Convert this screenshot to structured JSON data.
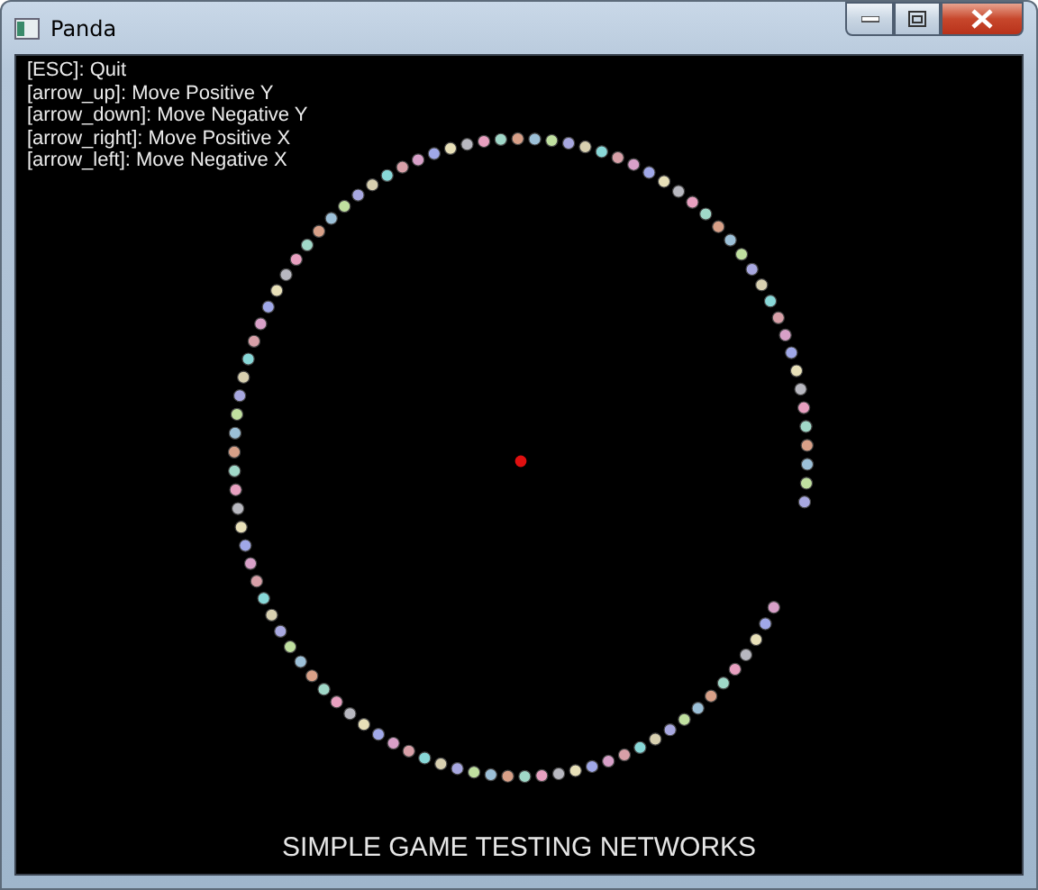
{
  "window": {
    "title": "Panda"
  },
  "help_lines": [
    "[ESC]: Quit",
    "[arrow_up]: Move Positive Y",
    "[arrow_down]: Move Negative Y",
    "[arrow_right]: Move Positive X",
    "[arrow_left]: Move Negative X"
  ],
  "caption": "SIMPLE GAME TESTING NETWORKS"
}
